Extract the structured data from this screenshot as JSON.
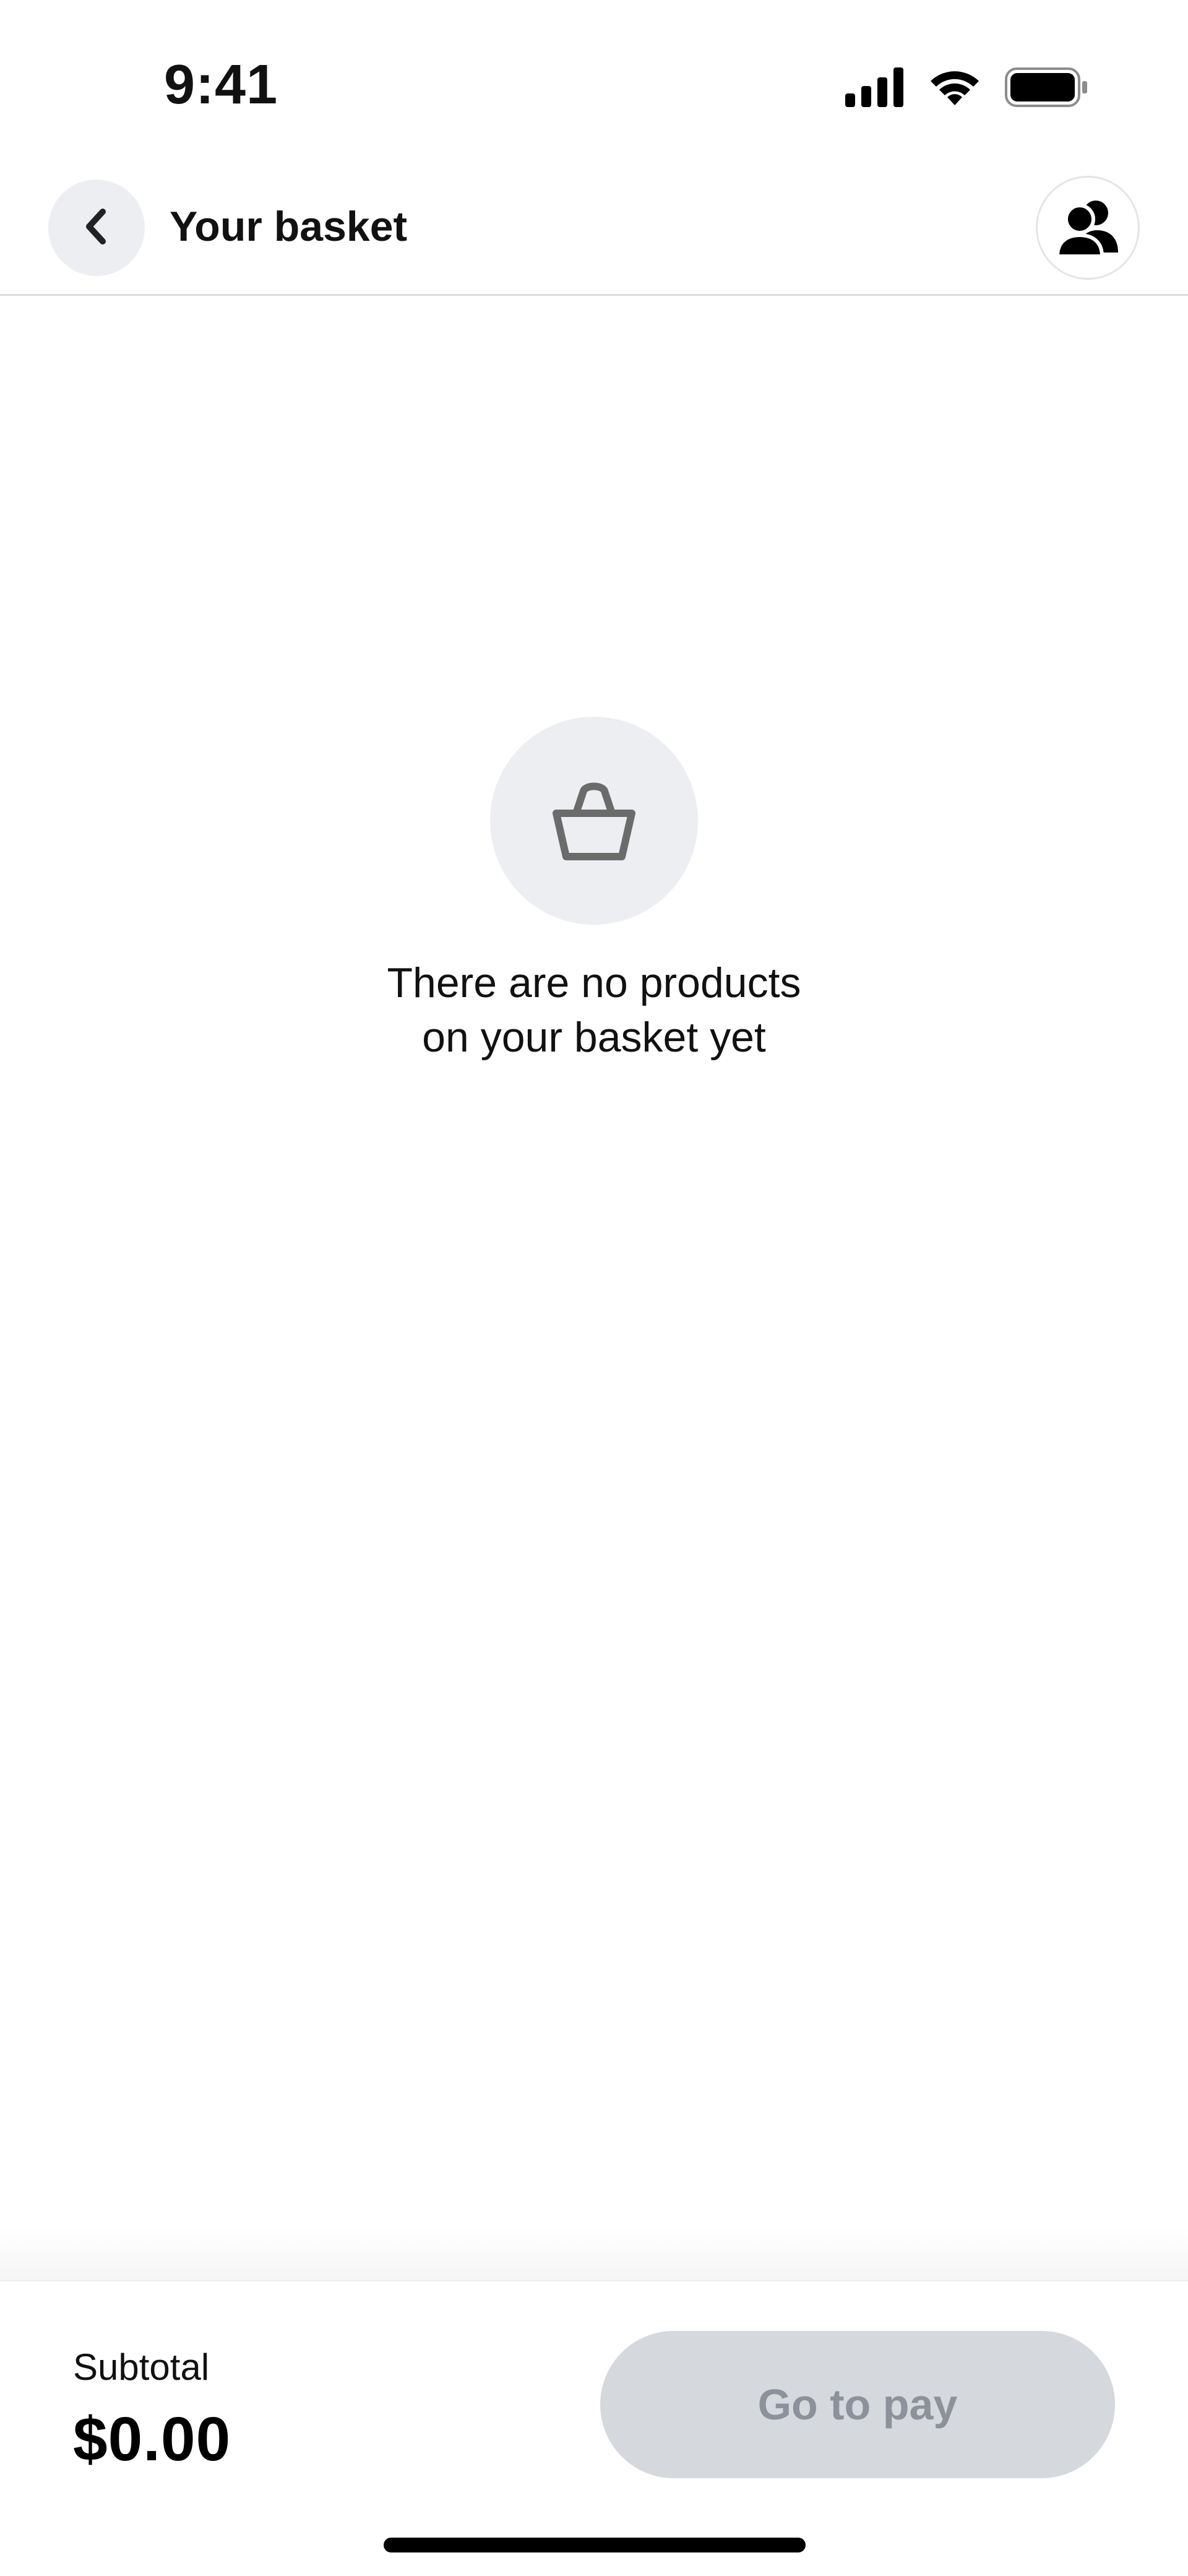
{
  "status_bar": {
    "time": "9:41",
    "icons": [
      "cellular-signal-icon",
      "wifi-icon",
      "battery-icon"
    ]
  },
  "header": {
    "title": "Your basket",
    "back_icon": "chevron-left-icon",
    "people_icon": "people-icon"
  },
  "empty_state": {
    "icon": "basket-icon",
    "line1": "There are no products",
    "line2": "on your basket yet"
  },
  "footer": {
    "subtotal_label": "Subtotal",
    "subtotal_value": "$0.00",
    "pay_button_label": "Go to pay",
    "pay_button_disabled": true
  },
  "colors": {
    "icon_circle_bg": "#eceef1",
    "disabled_button_bg": "#d5d8dd",
    "disabled_button_text": "#8d9199",
    "divider": "#dcdcdc"
  }
}
